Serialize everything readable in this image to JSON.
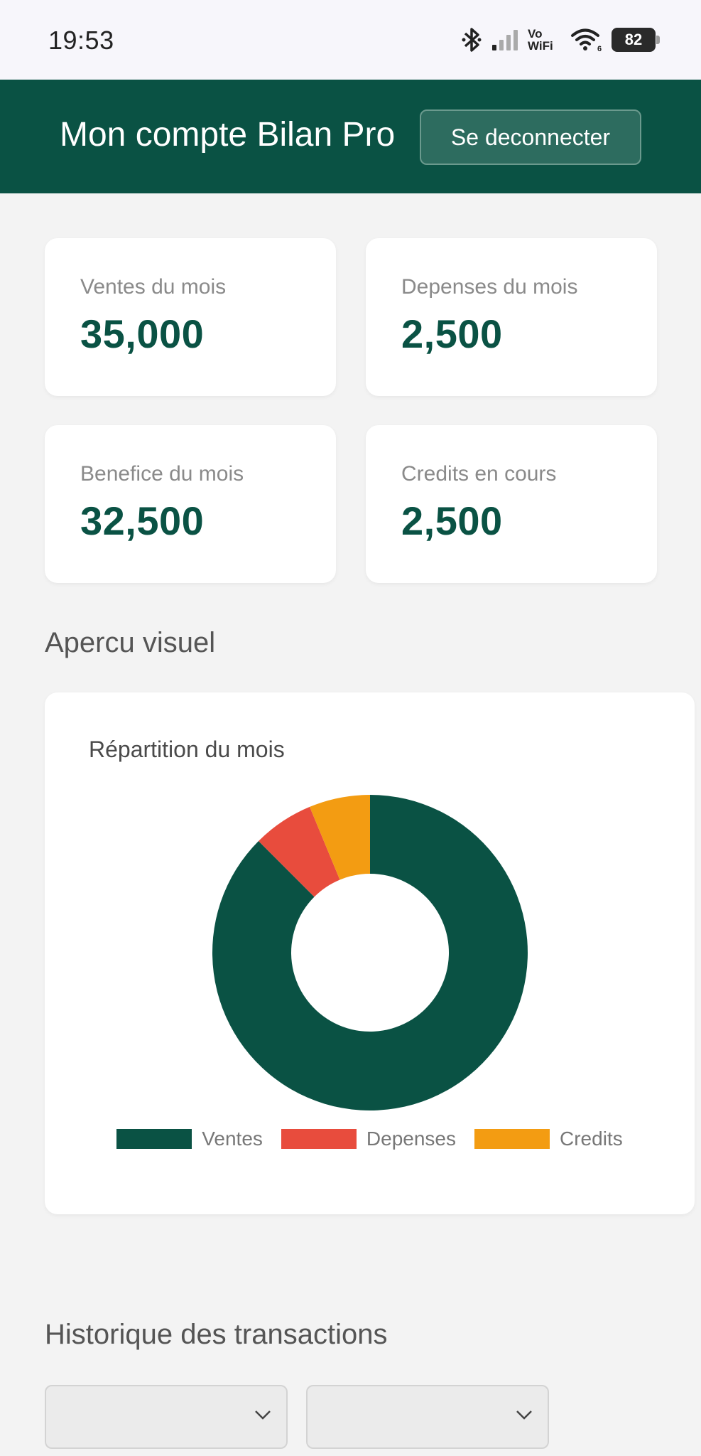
{
  "status_bar": {
    "time": "19:53",
    "vowifi_top": "Vo",
    "vowifi_bottom": "WiFi",
    "battery": "82",
    "icons": [
      "bluetooth-icon",
      "signal-icon",
      "wifi-icon",
      "battery-icon"
    ]
  },
  "header": {
    "title": "Mon compte Bilan Pro",
    "logout_label": "Se deconnecter",
    "background": "#0a5244"
  },
  "stats": [
    {
      "label": "Ventes du mois",
      "value": "35,000"
    },
    {
      "label": "Depenses du mois",
      "value": "2,500"
    },
    {
      "label": "Benefice du mois",
      "value": "32,500"
    },
    {
      "label": "Credits en cours",
      "value": "2,500"
    }
  ],
  "overview": {
    "section_title": "Apercu visuel"
  },
  "chart_data": {
    "type": "pie",
    "subtype": "doughnut",
    "title": "Répartition du mois",
    "categories": [
      "Ventes",
      "Depenses",
      "Credits"
    ],
    "values": [
      35000,
      2500,
      2500
    ],
    "colors": [
      "#0a5244",
      "#e84c3d",
      "#f39c12"
    ],
    "legend_position": "bottom"
  },
  "history": {
    "section_title": "Historique des transactions",
    "filters": [
      {
        "selected": ""
      },
      {
        "selected": ""
      }
    ]
  }
}
